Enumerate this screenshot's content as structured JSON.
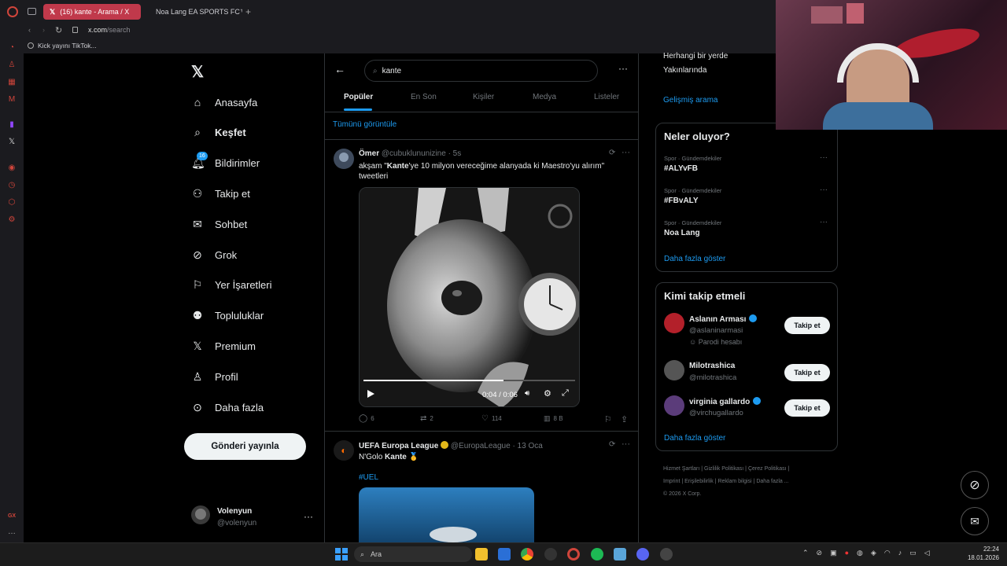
{
  "browser": {
    "tabs": [
      {
        "label": "(16) kante - Arama / X",
        "active": true
      },
      {
        "label": "Noa Lang EA SPORTS FC™",
        "active": false
      }
    ],
    "url_host": "x.com",
    "url_path": "/search",
    "bookmark": "Kick yayını TikTok..."
  },
  "nav": {
    "logo": "X",
    "items": [
      {
        "label": "Anasayfa",
        "icon": "home-icon"
      },
      {
        "label": "Keşfet",
        "icon": "search-icon",
        "bold": true
      },
      {
        "label": "Bildirimler",
        "icon": "bell-icon",
        "badge": "16"
      },
      {
        "label": "Takip et",
        "icon": "follow-icon"
      },
      {
        "label": "Sohbet",
        "icon": "mail-icon"
      },
      {
        "label": "Grok",
        "icon": "grok-icon"
      },
      {
        "label": "Yer İşaretleri",
        "icon": "bookmark-icon"
      },
      {
        "label": "Topluluklar",
        "icon": "communities-icon"
      },
      {
        "label": "Premium",
        "icon": "x-premium-icon"
      },
      {
        "label": "Profil",
        "icon": "profile-icon"
      },
      {
        "label": "Daha fazla",
        "icon": "more-circle-icon"
      }
    ],
    "post_button": "Gönderi yayınla",
    "user": {
      "name": "Volenyun",
      "handle": "@volenyun"
    }
  },
  "search": {
    "query": "kante",
    "tabs": [
      "Popüler",
      "En Son",
      "Kişiler",
      "Medya",
      "Listeler"
    ],
    "view_all": "Tümünü görüntüle"
  },
  "posts": [
    {
      "name": "Ömer",
      "handle": "@cubuklununizine",
      "time": "· 5s",
      "text_pre": "akşam \"",
      "text_bold": "Kante",
      "text_post": "'ye 10 milyon vereceğime alanyada ki Maestro'yu alırım\" tweetleri",
      "video_time": "0:04 / 0:06",
      "video_progress": 0.66,
      "replies": "6",
      "reposts": "2",
      "likes": "114",
      "views": "8 B"
    },
    {
      "name": "UEFA Europa League",
      "handle": "@EuropaLeague",
      "time": "· 13 Oca",
      "text_pre": "N'Golo ",
      "text_bold": "Kante",
      "emoji": "🥇",
      "hashtag": "#UEL"
    }
  ],
  "right": {
    "filter_partial": "Herhangi bir yerde",
    "filter_near": "Yakınlarında",
    "advanced": "Gelişmiş arama",
    "trends_title": "Neler oluyor?",
    "trends": [
      {
        "context": "Spor · Gündemdekiler",
        "name": "#ALYvFB"
      },
      {
        "context": "Spor · Gündemdekiler",
        "name": "#FBvALY"
      },
      {
        "context": "Spor · Gündemdekiler",
        "name": "Noa Lang"
      }
    ],
    "show_more": "Daha fazla göster",
    "who_title": "Kimi takip etmeli",
    "who": [
      {
        "name": "Aslanın Arması",
        "handle": "@aslaninarmasi",
        "note": "Parodi hesabı",
        "verified": true
      },
      {
        "name": "Milotrashica",
        "handle": "@milotrashica",
        "note": "",
        "verified": false
      },
      {
        "name": "virginia gallardo",
        "handle": "@virchugallardo",
        "note": "",
        "verified": true
      }
    ],
    "follow_label": "Takip et",
    "footer": [
      "Hizmet Şartları",
      "Gizlilik Politikası",
      "Çerez Politikası",
      "Imprint",
      "Erişilebilirlik",
      "Reklam bilgisi",
      "Daha fazla ...",
      "© 2026 X Corp."
    ]
  },
  "taskbar": {
    "search_label": "Ara",
    "time": "22:24",
    "date": "18.01.2026"
  },
  "colors": {
    "accent": "#1d9bf0",
    "opera_red": "#c0394b"
  }
}
